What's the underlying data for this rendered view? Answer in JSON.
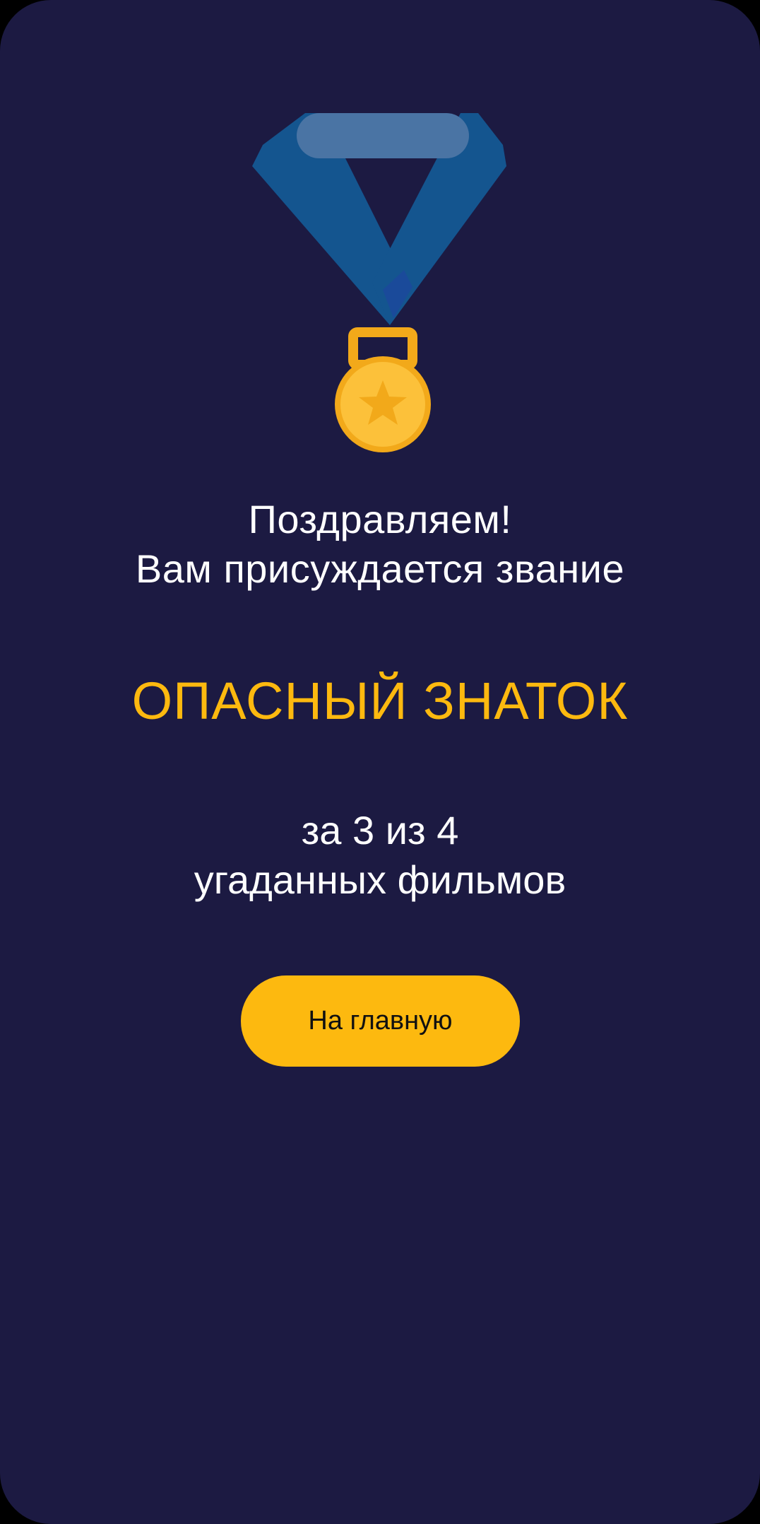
{
  "congrats": {
    "line1": "Поздравляем!",
    "line2": "Вам присуждается звание"
  },
  "rank": {
    "title": "ОПАСНЫЙ ЗНАТОК"
  },
  "score": {
    "line1": "за 3 из 4",
    "line2": "угаданных фильмов"
  },
  "home_button": {
    "label": "На главную"
  },
  "colors": {
    "background": "#1c1a42",
    "accent": "#fdb90f",
    "ribbon": "#14558f",
    "text": "#ffffff"
  },
  "icons": {
    "medal": "medal-icon",
    "star": "star-icon"
  }
}
